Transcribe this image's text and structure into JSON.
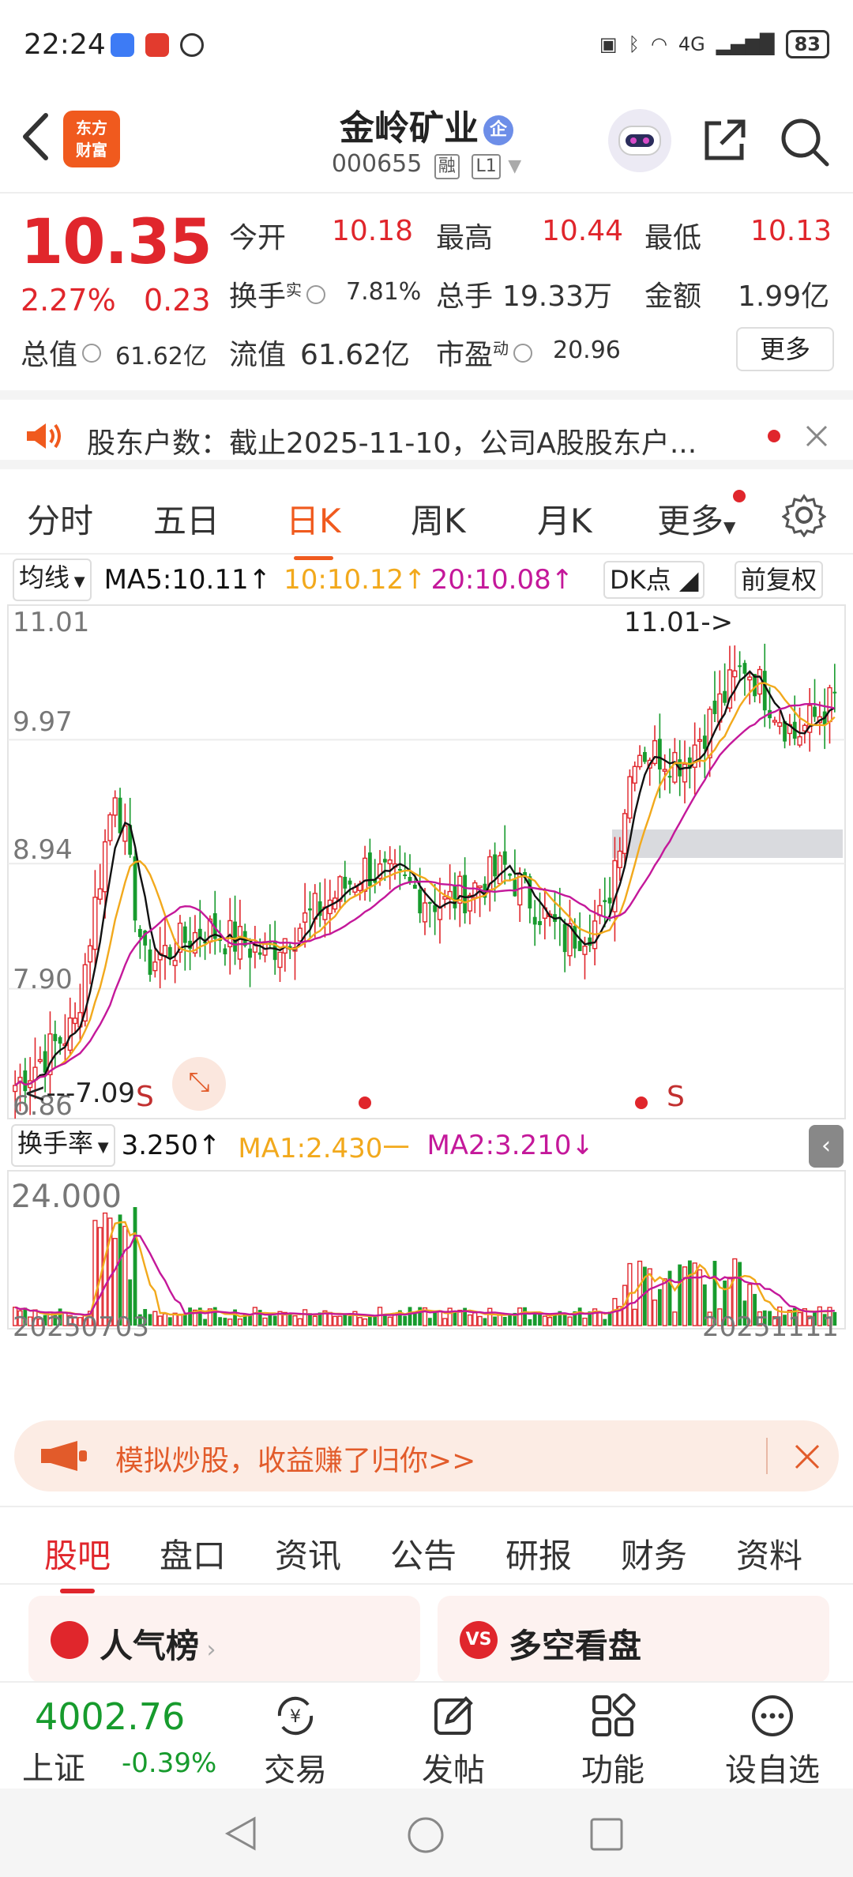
{
  "status_bar": {
    "time": "22:24",
    "battery": "83",
    "network": "4G"
  },
  "header": {
    "title": "金岭矿业",
    "title_badge": "企",
    "code": "000655",
    "tag1": "融",
    "tag2": "L1",
    "logo_line1": "东方",
    "logo_line2": "财富"
  },
  "quote": {
    "price": "10.35",
    "change_pct": "2.27%",
    "change": "0.23",
    "open_label": "今开",
    "open": "10.18",
    "high_label": "最高",
    "high": "10.44",
    "low_label": "最低",
    "low": "10.13",
    "turnover_label": "换手",
    "turnover_sup": "实",
    "turnover": "7.81%",
    "volume_label": "总手",
    "volume": "19.33万",
    "amount_label": "金额",
    "amount": "1.99亿",
    "total_value_label": "总值",
    "total_value": "61.62亿",
    "float_value_label": "流值",
    "float_value": "61.62亿",
    "pe_label": "市盈",
    "pe_sup": "动",
    "pe": "20.96",
    "more": "更多"
  },
  "notice": {
    "text": "股东户数：截止2025-11-10，公司A股股东户..."
  },
  "tabs": [
    "分时",
    "五日",
    "日K",
    "周K",
    "月K",
    "更多"
  ],
  "active_tab": "日K",
  "ma_row": {
    "selector": "均线",
    "ma5": "MA5:10.11↑",
    "ma10": "10:10.12↑",
    "ma20": "20:10.08↑",
    "dk": "DK点",
    "adjust": "前复权"
  },
  "kchart": {
    "y_labels": [
      "11.01",
      "9.97",
      "8.94",
      "7.90",
      "6.86"
    ],
    "high_marker": "11.01->",
    "low_marker": "<---7.09",
    "signal_s": "S",
    "signal_s2": "S"
  },
  "vol_row": {
    "selector": "换手率",
    "value": "3.250↑",
    "ma1": "MA1:2.430一",
    "ma2": "MA2:3.210↓"
  },
  "vchart": {
    "y_label": "24.000",
    "date_start": "20250703",
    "date_end": "20251111"
  },
  "colors": {
    "up": "#e0262c",
    "down": "#179b2d",
    "ma5": "#111111",
    "ma10": "#f2a91c",
    "ma20": "#c4189a",
    "accent": "#f05a1e"
  },
  "promo": {
    "text": "模拟炒股，收益赚了归你>>"
  },
  "bottom_tabs": [
    "股吧",
    "盘口",
    "资讯",
    "公告",
    "研报",
    "财务",
    "资料"
  ],
  "cards": {
    "left": "人气榜",
    "right": "多空看盘"
  },
  "bottom_nav": {
    "index_value": "4002.76",
    "index_name": "上证",
    "index_change": "-0.39%",
    "items": [
      "交易",
      "发帖",
      "功能",
      "设自选"
    ]
  }
}
